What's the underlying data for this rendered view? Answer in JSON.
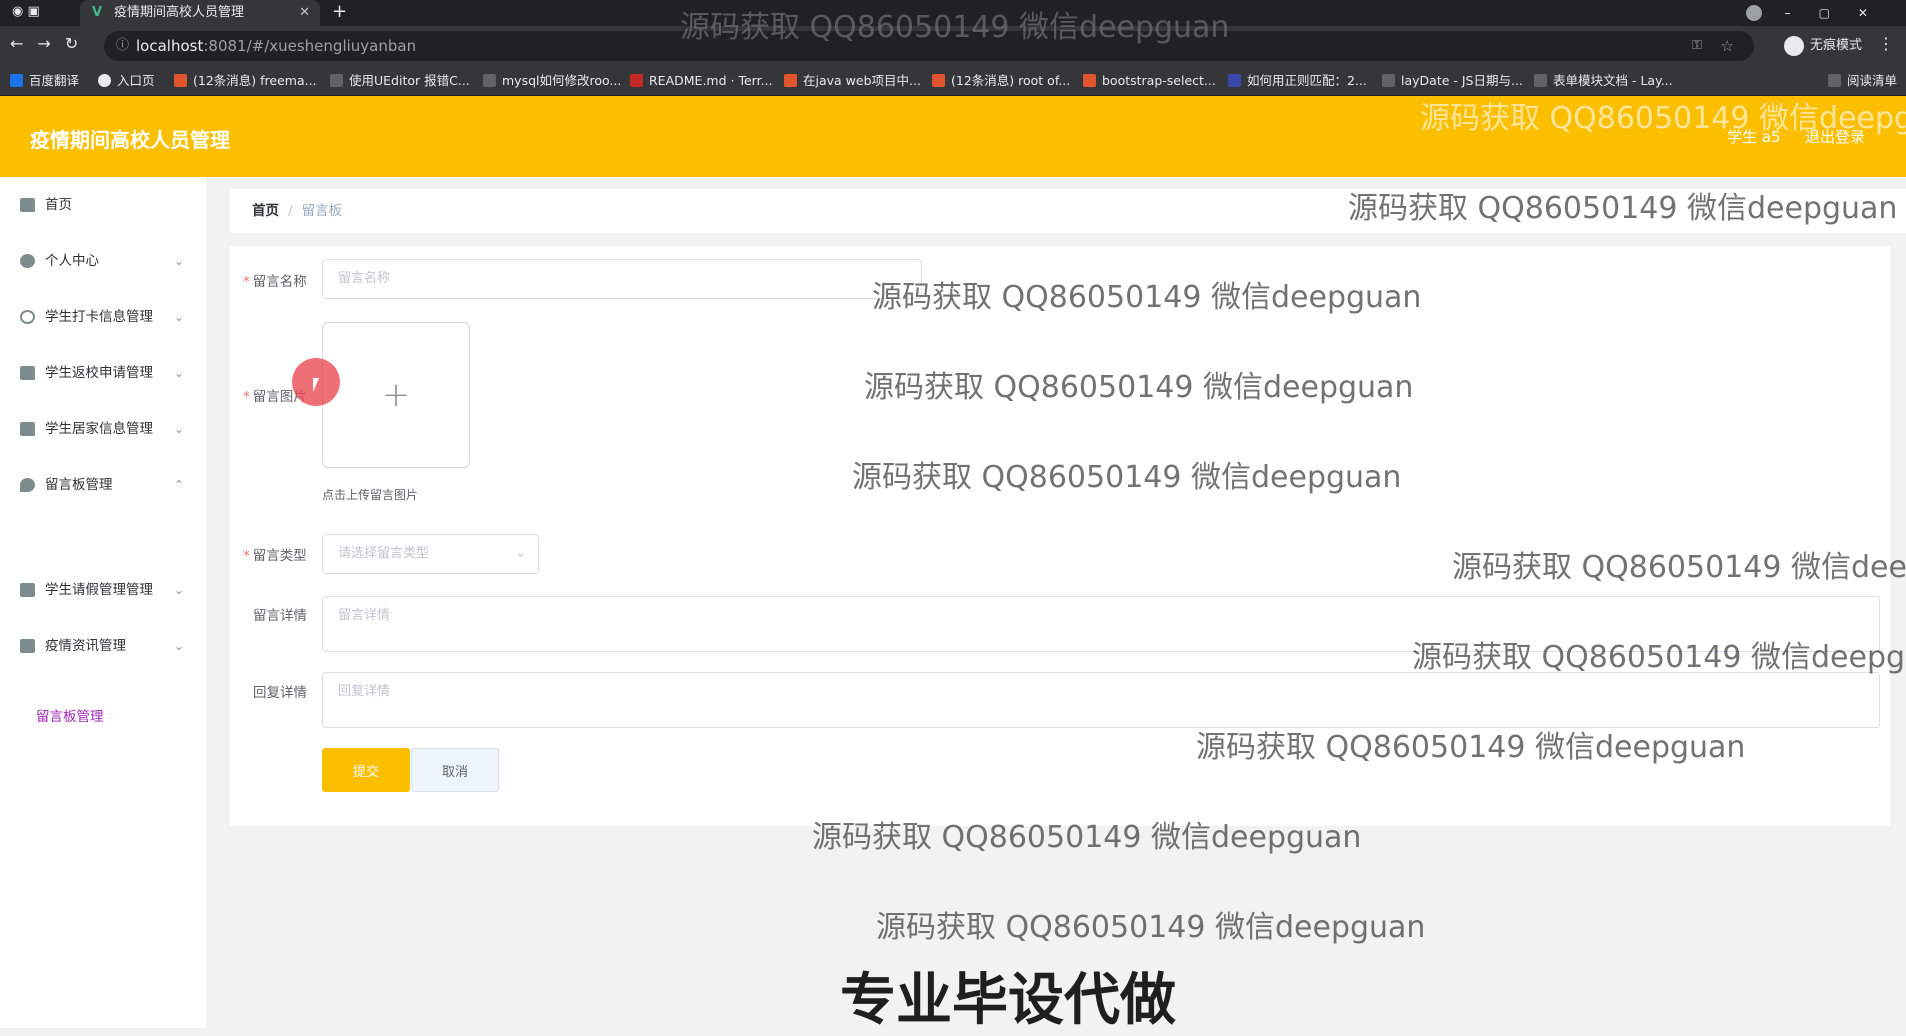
{
  "browser": {
    "tab_title": "疫情期间高校人员管理",
    "tab_favicon": "V",
    "url_host": "localhost",
    "url_path": ":8081/#/xueshengliuyanban",
    "incognito_label": "无痕模式",
    "bookmarks": [
      "百度翻译",
      "入口页",
      "(12条消息) freema...",
      "使用UEditor 报错C...",
      "mysql如何修改roo...",
      "README.md · Terr...",
      "在java web项目中...",
      "(12条消息) root of...",
      "bootstrap-select...",
      "如何用正则匹配：2...",
      "layDate - JS日期与...",
      "表单模块文档 - Lay...",
      "阅读清单"
    ]
  },
  "header": {
    "title": "疫情期间高校人员管理",
    "user": "学生 a5",
    "logout": "退出登录"
  },
  "sidebar": {
    "items": [
      {
        "label": "首页"
      },
      {
        "label": "个人中心"
      },
      {
        "label": "学生打卡信息管理"
      },
      {
        "label": "学生返校申请管理"
      },
      {
        "label": "学生居家信息管理"
      },
      {
        "label": "留言板管理"
      },
      {
        "label": "学生请假管理管理"
      },
      {
        "label": "疫情资讯管理"
      }
    ],
    "sub_item": "留言板管理"
  },
  "breadcrumb": {
    "home": "首页",
    "sep": "/",
    "current": "留言板"
  },
  "form": {
    "name_label": "留言名称",
    "name_placeholder": "留言名称",
    "image_label": "留言图片",
    "upload_tip": "点击上传留言图片",
    "type_label": "留言类型",
    "type_placeholder": "请选择留言类型",
    "detail_label": "留言详情",
    "detail_placeholder": "留言详情",
    "reply_label": "回复详情",
    "reply_placeholder": "回复详情",
    "submit": "提交",
    "cancel": "取消"
  },
  "watermark": {
    "text": "源码获取 QQ86050149 微信deepguan",
    "slogan": "专业毕设代做"
  },
  "colors": {
    "accent": "#fcbf00",
    "active_sub": "#9c27b0"
  }
}
